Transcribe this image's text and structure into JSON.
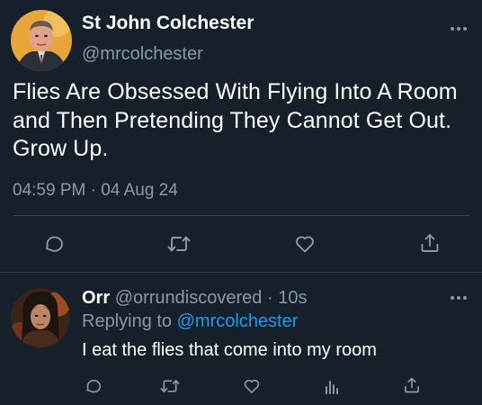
{
  "main_tweet": {
    "display_name": "St John Colchester",
    "handle": "@mrcolchester",
    "text": "Flies Are Obsessed With Flying Into A Room and Then Pretending They Cannot Get Out. Grow Up.",
    "timestamp": "04:59 PM · 04 Aug 24",
    "more_icon": "more-horizontal-icon",
    "actions": [
      "reply-icon",
      "retweet-icon",
      "like-icon",
      "share-icon"
    ]
  },
  "reply": {
    "display_name": "Orr",
    "handle": "@orrundiscovered",
    "separator": "·",
    "time": "10s",
    "replying_to_prefix": "Replying to",
    "replying_to_handle": "@mrcolchester",
    "text": "I eat the flies that come into my room",
    "more_icon": "more-horizontal-icon",
    "actions": [
      "reply-icon",
      "retweet-icon",
      "like-icon",
      "analytics-icon",
      "share-icon"
    ]
  },
  "colors": {
    "background": "#15202b",
    "text_primary": "#ffffff",
    "text_secondary": "#8b98a5",
    "link": "#1d9bf0",
    "divider": "#38444d"
  }
}
